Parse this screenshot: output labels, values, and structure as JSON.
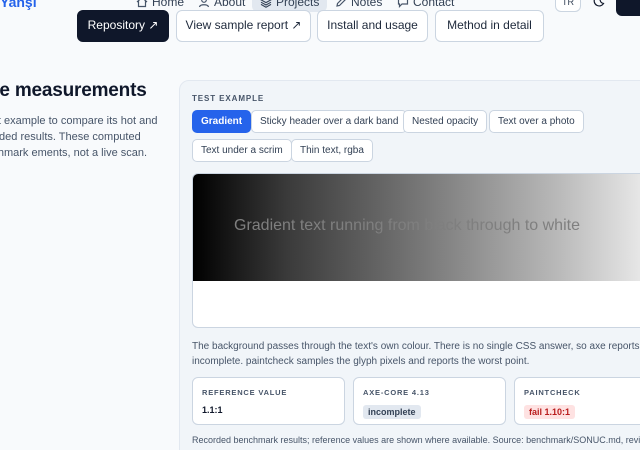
{
  "nav": {
    "brand": "Yanşı",
    "items": [
      {
        "label": "Home",
        "icon": "home-icon"
      },
      {
        "label": "About",
        "icon": "user-icon"
      },
      {
        "label": "Projects",
        "icon": "layers-icon"
      },
      {
        "label": "Notes",
        "icon": "pen-icon"
      },
      {
        "label": "Contact",
        "icon": "chat-icon"
      }
    ],
    "avatar": "TR",
    "theme_icon": "moon-icon"
  },
  "actions": {
    "repository": "Repository ↗",
    "sample_report": "View sample report ↗",
    "install": "Install and usage",
    "method": "Method in detail"
  },
  "intro": {
    "heading": "he measurements",
    "body": "a test example to compare its hot and recorded results. These computed benchmark ements, not a live scan."
  },
  "card": {
    "eyebrow": "TEST EXAMPLE",
    "chips": [
      "Gradient",
      "Sticky header over a dark band",
      "Nested opacity",
      "Text over a photo",
      "Text under a scrim",
      "Thin text, rgba"
    ],
    "active_chip": "Gradient",
    "preview_text": "Gradient text running from black through to white",
    "explanation": "The background passes through the text's own colour. There is no single CSS answer, so axe reports incomplete. paintcheck samples the glyph pixels and reports the worst point.",
    "results": {
      "reference": {
        "label": "REFERENCE VALUE",
        "value": "1.1:1"
      },
      "axe": {
        "label": "AXE-CORE 4.13",
        "value": "incomplete"
      },
      "paintcheck": {
        "label": "PAINTCHECK",
        "value": "fail 1.10:1"
      }
    },
    "footnote": "Recorded benchmark results; reference values are shown where available. Source: benchmark/SONUC.md, revision"
  },
  "colors": {
    "accent": "#2563eb",
    "dark": "#0f172a",
    "fail": "#b91c1c",
    "fail_bg": "#fee2e2"
  }
}
